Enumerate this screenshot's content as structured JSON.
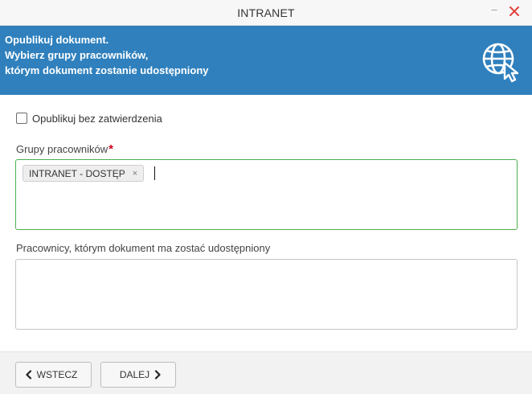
{
  "window": {
    "title": "INTRANET",
    "minimize_glyph": "–",
    "close_icon": "close-icon"
  },
  "banner": {
    "line1": "Opublikuj dokument.",
    "line2": "Wybierz grupy pracowników,",
    "line3": "którym dokument zostanie udostępniony",
    "icon": "globe-cursor-icon",
    "background": "#2f80bd"
  },
  "form": {
    "publish_without_approval_label": "Opublikuj bez zatwierdzenia",
    "publish_without_approval_checked": false,
    "groups_label": "Grupy pracowników",
    "required_mark": "*",
    "selected_groups": [
      {
        "label": "INTRANET - DOSTĘP",
        "remove_glyph": "×"
      }
    ],
    "employees_label": "Pracownicy, którym dokument ma zostać udostępniony"
  },
  "footer": {
    "back_label": "WSTECZ",
    "next_label": "DALEJ"
  },
  "colors": {
    "accent_blue": "#2f80bd",
    "valid_border": "#4caf50",
    "required": "#d0021b",
    "close": "#e2413b"
  }
}
